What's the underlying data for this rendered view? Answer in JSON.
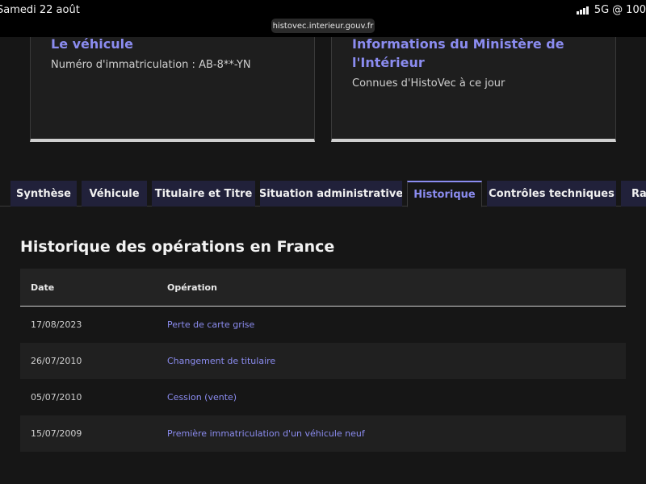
{
  "status": {
    "time": "Samedi 22 août",
    "network": "5G",
    "battery": "100"
  },
  "browser": {
    "url": "histovec.interieur.gouv.fr"
  },
  "cards": [
    {
      "title": "Le véhicule",
      "subtitle": "Numéro d'immatriculation : AB-8**-YN"
    },
    {
      "title": "Informations du Ministère de l'Intérieur",
      "subtitle": "Connues d'HistoVec à ce jour"
    }
  ],
  "tabs": [
    {
      "label": "Synthèse",
      "active": false
    },
    {
      "label": "Véhicule",
      "active": false
    },
    {
      "label": "Titulaire et Titre",
      "active": false
    },
    {
      "label": "Situation administrative",
      "active": false
    },
    {
      "label": "Historique",
      "active": true
    },
    {
      "label": "Contrôles techniques",
      "active": false
    },
    {
      "label": "Rapport",
      "active": false
    }
  ],
  "history": {
    "title": "Historique des opérations en France",
    "columns": {
      "date": "Date",
      "operation": "Opération"
    },
    "rows": [
      {
        "date": "17/08/2023",
        "operation": "Perte de carte grise"
      },
      {
        "date": "26/07/2010",
        "operation": "Changement de titulaire"
      },
      {
        "date": "05/07/2010",
        "operation": "Cession (vente)"
      },
      {
        "date": "15/07/2009",
        "operation": "Première immatriculation d'un véhicule neuf"
      }
    ]
  },
  "colors": {
    "accent": "#8b8cf0",
    "background": "#161616",
    "tab_bg": "#21213a"
  }
}
